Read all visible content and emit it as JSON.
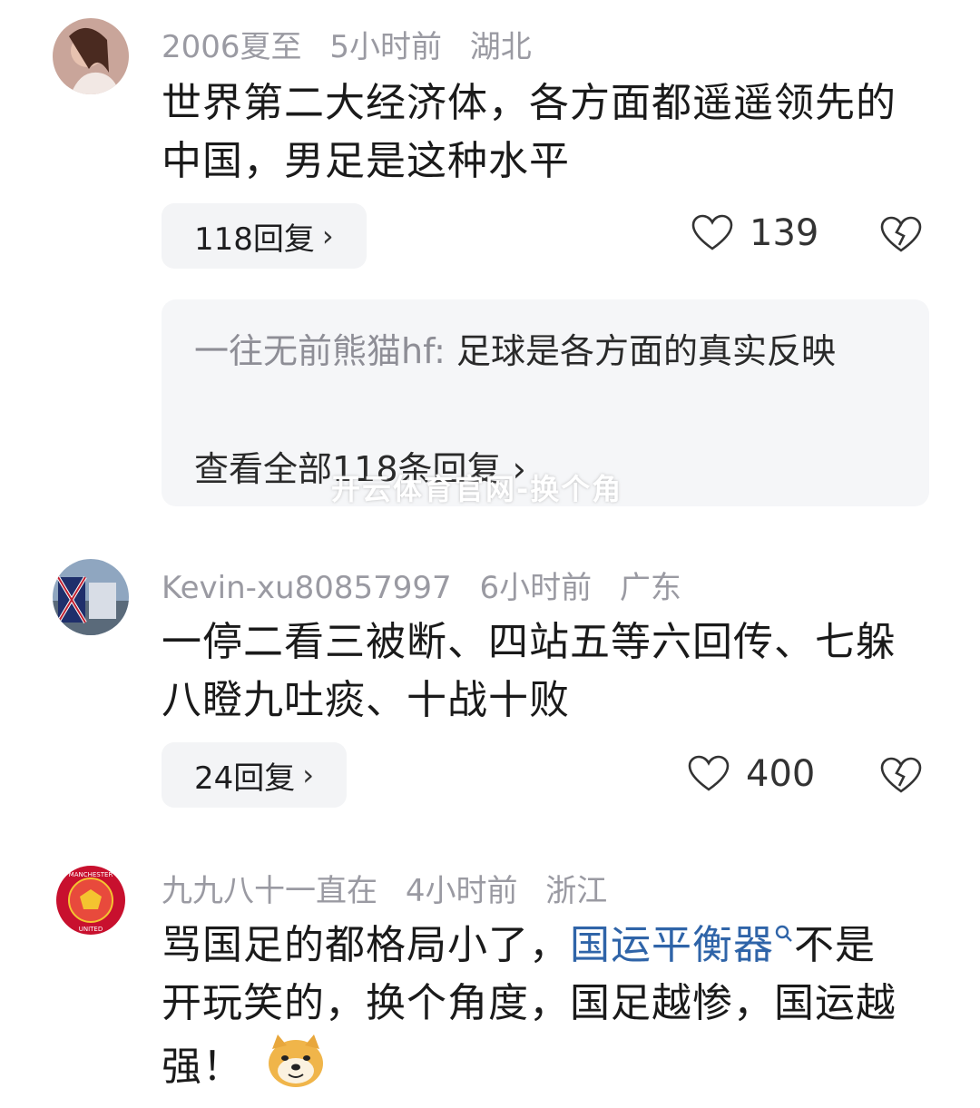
{
  "comments": [
    {
      "username": "2006夏至",
      "time": "5小时前",
      "location": "湖北",
      "text": "世界第二大经济体，各方面都遥遥领先的中国，男足是这种水平",
      "replies_label": "118回复",
      "likes": "139",
      "sub_reply": {
        "user": "一往无前熊猫hf:",
        "text": " 足球是各方面的真实反映",
        "view_all": "查看全部118条回复"
      }
    },
    {
      "username": "Kevin-xu80857997",
      "time": "6小时前",
      "location": "广东",
      "text": "一停二看三被断、四站五等六回传、七躲八瞪九吐痰、十战十败",
      "replies_label": "24回复",
      "likes": "400"
    },
    {
      "username": "九九八十一直在",
      "time": "4小时前",
      "location": "浙江",
      "text_before": "骂国足的都格局小了，",
      "link_text": "国运平衡器",
      "text_after": "不是开玩笑的，换个角度，国足越惨，国运越强！"
    }
  ],
  "watermark": "开云体育官网-换个角",
  "icons": {
    "like": "heart-outline-icon",
    "dislike": "broken-heart-icon",
    "chevron": "chevron-right-icon",
    "search": "search-icon",
    "emoji": "doge-emoji-icon"
  },
  "colors": {
    "meta": "#9a9aa2",
    "link": "#2f64a8",
    "pill_bg": "#f3f4f6"
  }
}
